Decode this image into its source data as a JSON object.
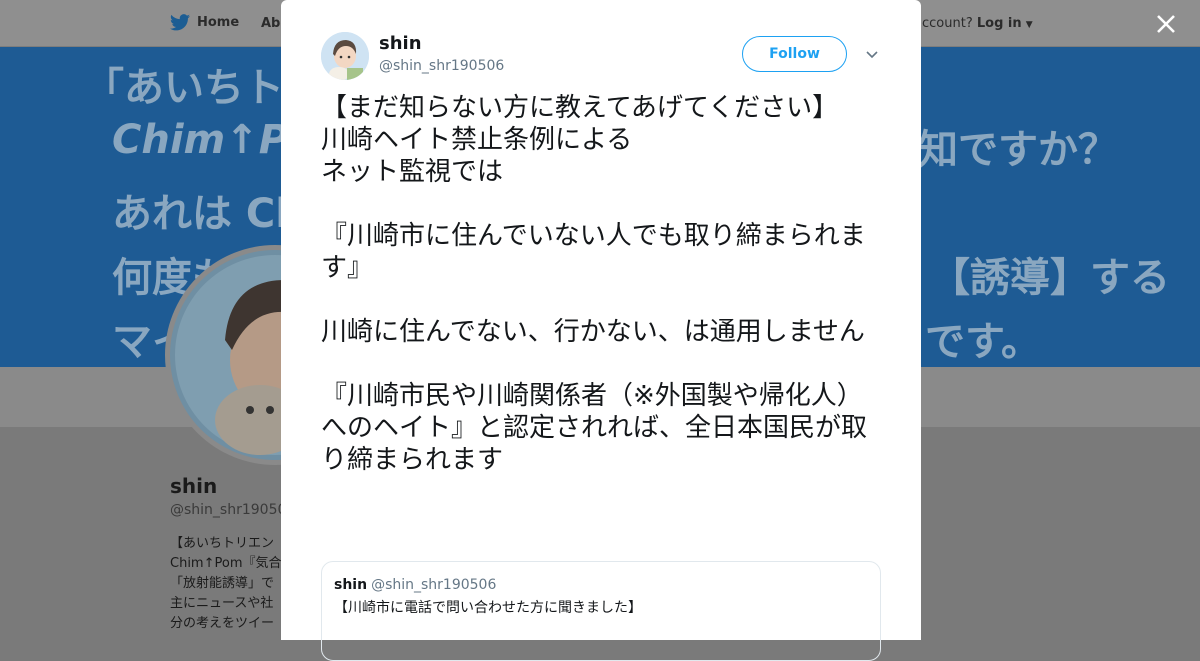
{
  "background": {
    "nav": {
      "home_label": "Home",
      "about_label": "Abo",
      "account_text": "ccount?",
      "login_label": "Log in"
    },
    "banner_lines": [
      "「あいちトリ",
      "Chim↑P",
      "知ですか？",
      "あれは Ch",
      "何度も",
      "【誘導】する",
      "マイ",
      "です。"
    ],
    "profile": {
      "name": "shin",
      "handle": "@shin_shr190506",
      "bio": [
        "【あいちトリエン",
        "Chim↑Pom『気合",
        "「放射能誘導」で",
        "主にニュースや社",
        "分の考えをツイー"
      ]
    }
  },
  "tweet": {
    "name": "shin",
    "handle": "@shin_shr190506",
    "follow_label": "Follow",
    "text": "【まだ知らない方に教えてあげてください】\n川崎ヘイト禁止条例による\nネット監視では\n\n『川崎市に住んでいない人でも取り締まられます』\n\n川崎に住んでない、行かない、は通用しません\n\n『川崎市民や川崎関係者（※外国製や帰化人）へのヘイト』と認定されれば、全日本国民が取り締まられます",
    "quote": {
      "name": "shin",
      "handle": "@shin_shr190506",
      "text": "【川崎市に電話で問い合わせた方に聞きました】"
    }
  },
  "colors": {
    "accent": "#1da1f2",
    "banner": "#1e5b94",
    "overlay": "#7a7a7a"
  }
}
